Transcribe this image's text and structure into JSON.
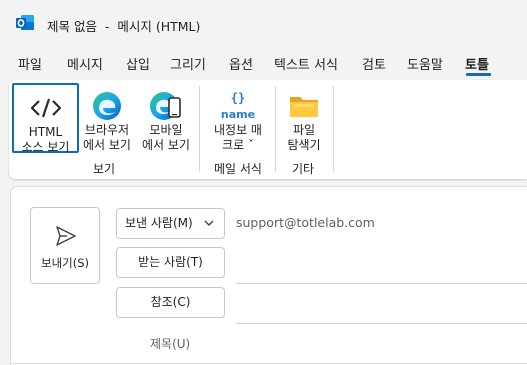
{
  "window": {
    "title": "제목 없음  -  메시지 (HTML)",
    "app_icon": "outlook-icon"
  },
  "tabs": [
    {
      "label": "파일"
    },
    {
      "label": "메시지"
    },
    {
      "label": "삽입"
    },
    {
      "label": "그리기"
    },
    {
      "label": "옵션"
    },
    {
      "label": "텍스트 서식"
    },
    {
      "label": "검토"
    },
    {
      "label": "도움말"
    },
    {
      "label": "토틀",
      "active": true
    }
  ],
  "ribbon": {
    "view_group": {
      "label": "보기",
      "buttons": [
        {
          "line1": "HTML",
          "line2": "소스 보기",
          "icon": "html-source-code-icon",
          "selected": true
        },
        {
          "line1": "브라우저",
          "line2": "에서 보기",
          "icon": "edge-browser-icon"
        },
        {
          "line1": "모바일",
          "line2": "에서 보기",
          "icon": "edge-mobile-icon"
        }
      ]
    },
    "mail_format_group": {
      "label": "메일 서식",
      "buttons": [
        {
          "line1": "내정보 매",
          "line2": "크로 ˇ",
          "icon": "name-macro-icon"
        }
      ]
    },
    "etc_group": {
      "label": "기타",
      "buttons": [
        {
          "line1": "파일",
          "line2": "탐색기",
          "icon": "folder-icon"
        }
      ]
    }
  },
  "compose": {
    "send_label": "보내기(S)",
    "from_label": "보낸 사람(M)",
    "from_value": "support@totlelab.com",
    "to_label": "받는 사람(T)",
    "cc_label": "참조(C)",
    "subject_label": "제목(U)"
  },
  "colors": {
    "accent": "#0f6cbd",
    "chrome_bg": "#f3f3f3",
    "outlook_blue": "#0364b8"
  }
}
